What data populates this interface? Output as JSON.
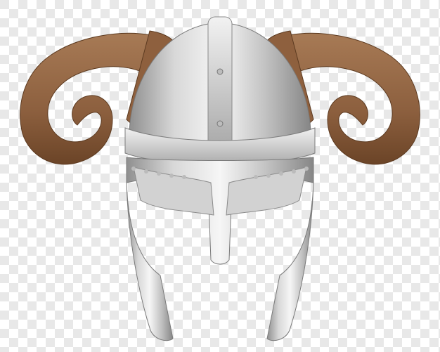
{
  "image": {
    "subject": "horned-helmet",
    "background": "transparency-checkerboard"
  },
  "colors": {
    "checker_light": "#ffffff",
    "checker_dark": "#e8e8e8",
    "steel_light": "#f4f4f4",
    "steel_mid": "#c9c9c9",
    "steel_dark": "#8f8f8f",
    "horn_light": "#a77a55",
    "horn_mid": "#8c5f3e",
    "horn_dark": "#6b4427"
  }
}
